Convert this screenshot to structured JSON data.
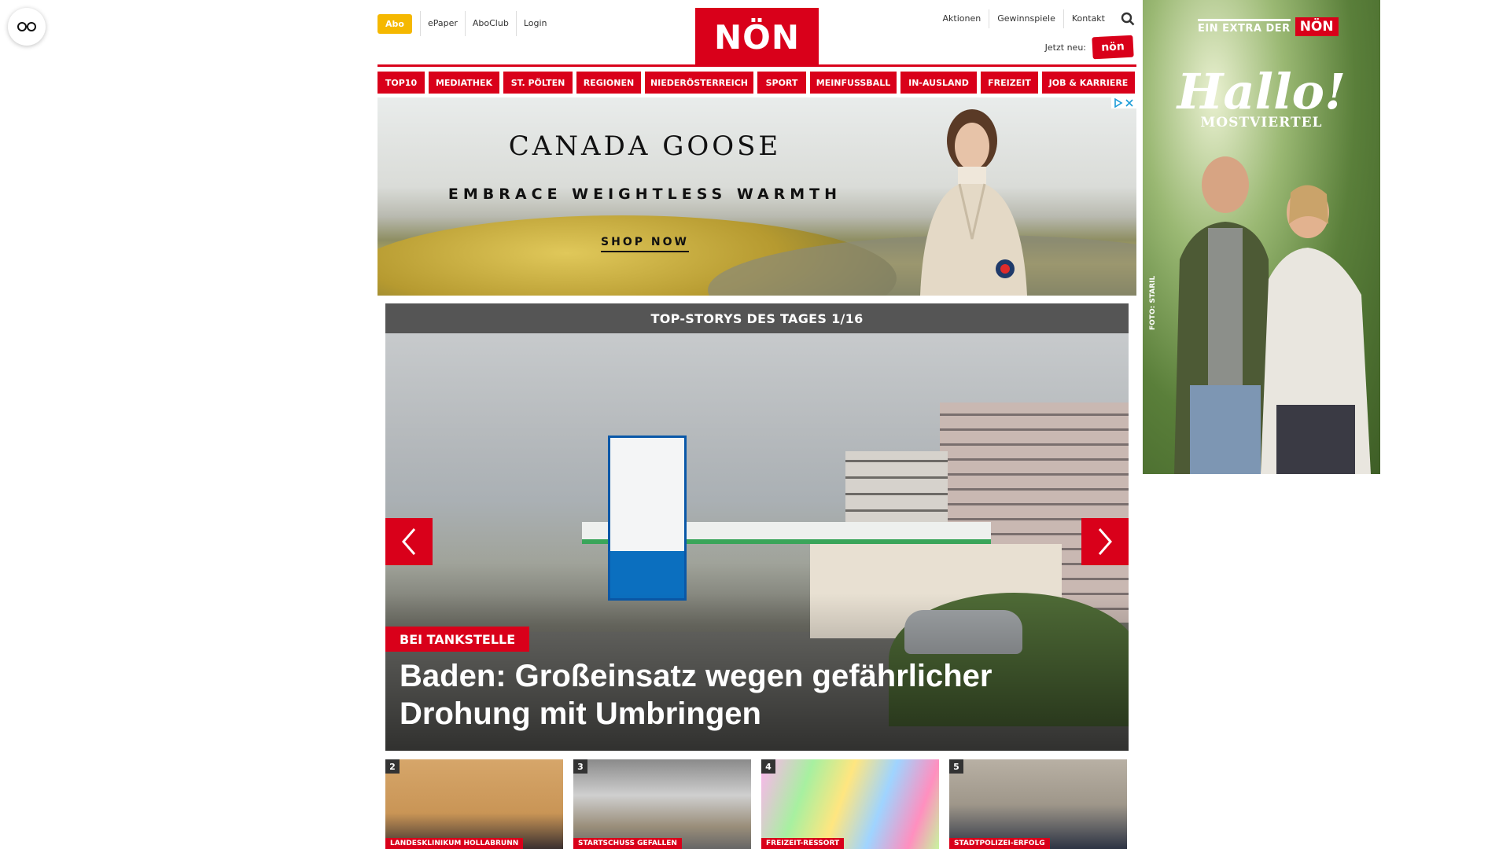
{
  "topnav": {
    "abo": "Abo",
    "links": [
      "ePaper",
      "AboClub",
      "Login"
    ]
  },
  "logo": "NÖN",
  "rightnav": {
    "links": [
      "Aktionen",
      "Gewinnspiele",
      "Kontakt"
    ],
    "jetzt_label": "Jetzt neu:",
    "app_badge": "nön"
  },
  "categories": [
    "TOP10",
    "MEDIATHEK",
    "ST. PÖLTEN",
    "REGIONEN",
    "NIEDERÖSTERREICH",
    "SPORT",
    "MEINFUSSBALL",
    "IN-AUSLAND",
    "FREIZEIT",
    "JOB & KARRIERE"
  ],
  "ad": {
    "brand": "CANADA GOOSE",
    "tagline": "EMBRACE WEIGHTLESS WARMTH",
    "cta": "SHOP NOW"
  },
  "stories": {
    "header": "TOP-STORYS DES TAGES 1/16",
    "hero_kicker": "BEI TANKSTELLE",
    "hero_headline": "Baden: Großeinsatz wegen gefährlicher Drohung mit Umbringen",
    "thumbs": [
      {
        "num": "2",
        "label": "LANDESKLINIKUM HOLLABRUNN"
      },
      {
        "num": "3",
        "label": "STARTSCHUSS GEFALLEN"
      },
      {
        "num": "4",
        "label": "FREIZEIT-RESSORT"
      },
      {
        "num": "5",
        "label": "STADTPOLIZEI-ERFOLG"
      }
    ]
  },
  "sidead": {
    "extra": "EIN EXTRA DER",
    "logo": "NÖN",
    "hallo": "Hallo!",
    "region": "MOSTVIERTEL",
    "credit": "FOTO: STARIL"
  },
  "colors": {
    "brand_red": "#d9001a",
    "abo_yellow": "#f5b800",
    "stories_header": "#555555"
  }
}
